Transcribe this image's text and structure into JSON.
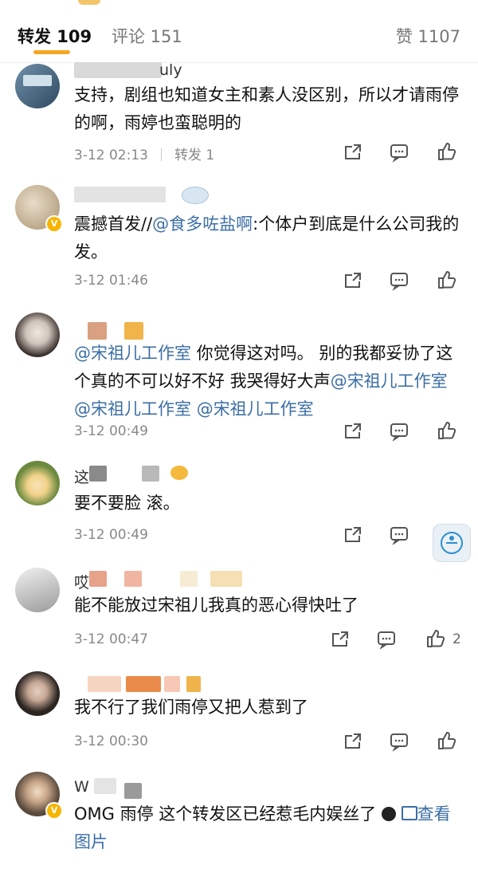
{
  "tabs": [
    {
      "label": "转发 109"
    },
    {
      "label": "评论 151"
    },
    {
      "label": "赞 1107"
    }
  ],
  "comments": [
    {
      "nick_visible": "uly",
      "text": "支持，剧组也知道女主和素人没区别，所以才请雨停的啊，雨婷也蛮聪明的",
      "time": "3-12 02:13",
      "repost": "转发 1",
      "likes": ""
    },
    {
      "nick_visible": "",
      "text_pre": "震撼首发//",
      "mention": "@食多咗盐啊",
      "text_post": ":个体户到底是什么公司我的发。",
      "time": "3-12 01:46",
      "likes": ""
    },
    {
      "nick_visible": "",
      "m1": "@宋祖儿工作室",
      "t1": " 你觉得这对吗。 别的我都妥协了这个真的不可以好不好 我哭得好大声",
      "m2": "@宋祖儿工作室",
      "m3": "@宋祖儿工作室",
      "m4": "@宋祖儿工作室",
      "time": "3-12 00:49",
      "likes": ""
    },
    {
      "nick_visible": "这",
      "text": "要不要脸 滚。",
      "time": "3-12 00:49",
      "likes": ""
    },
    {
      "nick_visible": "哎",
      "text": "能不能放过宋祖儿我真的恶心得快吐了",
      "time": "3-12 00:47",
      "likes": "2"
    },
    {
      "nick_visible": "",
      "text": "我不行了我们雨停又把人惹到了",
      "time": "3-12 00:30",
      "likes": ""
    },
    {
      "nick_visible": "W",
      "text": "OMG 雨停 这个转发区已经惹毛内娱丝了",
      "view_image": "查看图片",
      "time": "",
      "likes": ""
    }
  ],
  "colors": {
    "accent": "#f5a623",
    "link": "#3b6ea5",
    "meta": "#888888"
  }
}
